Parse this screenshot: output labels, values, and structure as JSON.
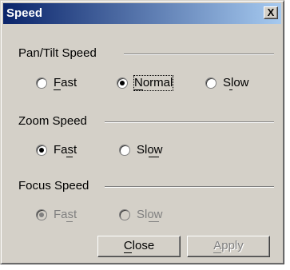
{
  "window": {
    "title": "Speed",
    "close_glyph": "X"
  },
  "pan_tilt": {
    "label": "Pan/Tilt Speed",
    "options": [
      {
        "label": "Fast",
        "selected": false
      },
      {
        "label": "Normal",
        "selected": true
      },
      {
        "label": "Slow",
        "selected": false
      }
    ]
  },
  "zoom": {
    "label": "Zoom Speed",
    "options": [
      {
        "label": "Fast",
        "selected": true
      },
      {
        "label": "Slow",
        "selected": false
      }
    ]
  },
  "focus": {
    "label": "Focus Speed",
    "enabled": false,
    "options": [
      {
        "label": "Fast",
        "selected": true
      },
      {
        "label": "Slow",
        "selected": false
      }
    ]
  },
  "buttons": {
    "close_label": "Close",
    "apply_label": "Apply",
    "apply_enabled": false
  },
  "colors": {
    "face": "#d4d0c8",
    "title_start": "#0a246a",
    "title_end": "#a6caf0",
    "disabled_text": "#808080"
  }
}
